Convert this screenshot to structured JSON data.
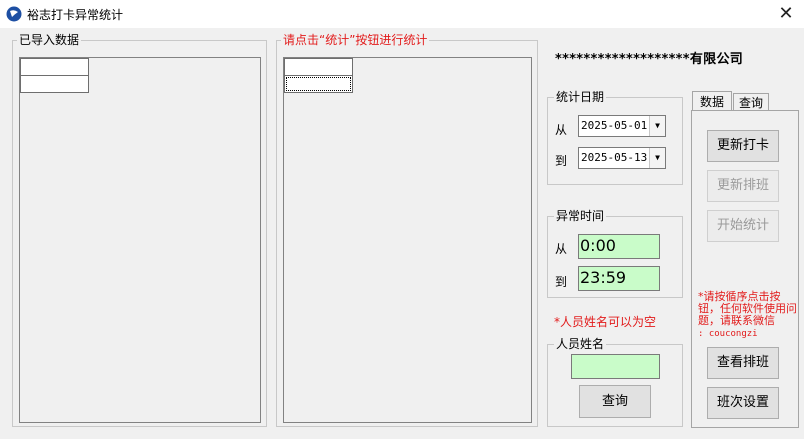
{
  "window": {
    "title": "裕志打卡异常统计",
    "close": "✕"
  },
  "left_group": {
    "label": "已导入数据"
  },
  "middle_group": {
    "label": "请点击“统计”按钮进行统计"
  },
  "company": "*******************有限公司",
  "date_group": {
    "label": "统计日期",
    "from_label": "从",
    "from_value": "2025-05-01",
    "to_label": "到",
    "to_value": "2025-05-13"
  },
  "time_group": {
    "label": "异常时间",
    "from_label": "从",
    "from_value": "0:00",
    "to_label": "到",
    "to_value": "23:59"
  },
  "name_hint": "*人员姓名可以为空",
  "name_group": {
    "label": "人员姓名",
    "value": "",
    "query_label": "查询"
  },
  "tabs": [
    {
      "label": "数据"
    },
    {
      "label": "查询"
    }
  ],
  "panel": {
    "update_punch": "更新打卡",
    "update_schedule": "更新排班",
    "start_stats": "开始统计",
    "note": "*请按循序点击按钮，任何软件使用问题，请联系微信",
    "contact": ": coucongzi",
    "view_schedule": "查看排班",
    "shift_settings": "班次设置"
  },
  "colors": {
    "accent_red": "#e21b1b",
    "input_green": "#c9fcc9"
  }
}
